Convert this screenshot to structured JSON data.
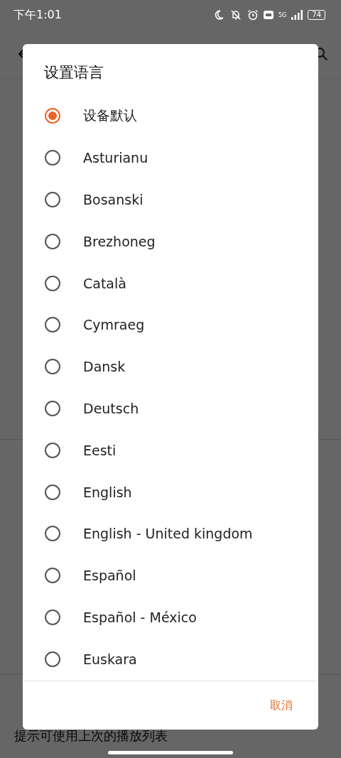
{
  "status_bar": {
    "time": "下午1:01",
    "network": "5G",
    "battery": "74"
  },
  "background": {
    "last_item": "提示可使用上次的播放列表"
  },
  "dialog": {
    "title": "设置语言",
    "options": [
      {
        "label": "设备默认",
        "selected": true
      },
      {
        "label": "Asturianu",
        "selected": false
      },
      {
        "label": "Bosanski",
        "selected": false
      },
      {
        "label": "Brezhoneg",
        "selected": false
      },
      {
        "label": "Català",
        "selected": false
      },
      {
        "label": "Cymraeg",
        "selected": false
      },
      {
        "label": "Dansk",
        "selected": false
      },
      {
        "label": "Deutsch",
        "selected": false
      },
      {
        "label": "Eesti",
        "selected": false
      },
      {
        "label": "English",
        "selected": false
      },
      {
        "label": "English - United kingdom",
        "selected": false
      },
      {
        "label": "Español",
        "selected": false
      },
      {
        "label": "Español - México",
        "selected": false
      },
      {
        "label": "Euskara",
        "selected": false
      }
    ],
    "cancel": "取消"
  }
}
